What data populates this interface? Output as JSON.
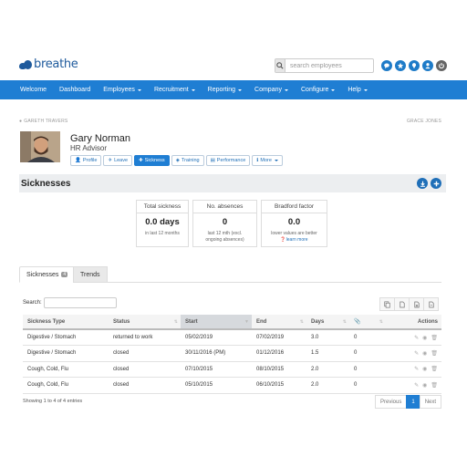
{
  "app": {
    "logo_text": "breathe",
    "brand_color": "#1f7ed3"
  },
  "search": {
    "placeholder": "search employees"
  },
  "top_icons": [
    "chat-icon",
    "star-icon",
    "pin-icon",
    "user-icon",
    "power-icon"
  ],
  "nav": {
    "items": [
      {
        "label": "Welcome",
        "dropdown": false
      },
      {
        "label": "Dashboard",
        "dropdown": false
      },
      {
        "label": "Employees",
        "dropdown": true
      },
      {
        "label": "Recruitment",
        "dropdown": true
      },
      {
        "label": "Reporting",
        "dropdown": true
      },
      {
        "label": "Company",
        "dropdown": true
      },
      {
        "label": "Configure",
        "dropdown": true
      },
      {
        "label": "Help",
        "dropdown": true
      }
    ]
  },
  "breadcrumbs": {
    "prev": "GARETH TRAVERS",
    "next": "GRACE JONES"
  },
  "employee": {
    "name": "Gary Norman",
    "role": "HR Advisor",
    "tabs": [
      {
        "label": "Profile",
        "icon": "user-icon",
        "active": false
      },
      {
        "label": "Leave",
        "icon": "plane-icon",
        "active": false
      },
      {
        "label": "Sickness",
        "icon": "medical-icon",
        "active": true
      },
      {
        "label": "Training",
        "icon": "graduation-cap-icon",
        "active": false
      },
      {
        "label": "Performance",
        "icon": "chart-icon",
        "active": false
      },
      {
        "label": "More",
        "icon": "info-icon",
        "active": false,
        "dropdown": true
      }
    ]
  },
  "section": {
    "title": "Sicknesses"
  },
  "stats": {
    "total": {
      "title": "Total sickness",
      "value": "0.0 days",
      "sub": "in last 12 months"
    },
    "absences": {
      "title": "No. absences",
      "value": "0",
      "sub_line1": "last 12 mth (excl.",
      "sub_line2": "ongoing absences)"
    },
    "bradford": {
      "title": "Bradford factor",
      "value": "0.0",
      "sub": "lower values are better",
      "link": "learn more"
    }
  },
  "tabs": {
    "active": "Sicknesses",
    "badge": "4",
    "inactive": "Trends"
  },
  "table": {
    "search_label": "Search:",
    "columns": [
      "Sickness Type",
      "Status",
      "Start",
      "End",
      "Days",
      "",
      "Actions"
    ],
    "rows": [
      [
        "Digestive / Stomach",
        "returned to work",
        "05/02/2019",
        "07/02/2019",
        "3.0",
        "0"
      ],
      [
        "Digestive / Stomach",
        "closed",
        "30/11/2016 (PM)",
        "01/12/2016",
        "1.5",
        "0"
      ],
      [
        "Cough, Cold, Flu",
        "closed",
        "07/10/2015",
        "08/10/2015",
        "2.0",
        "0"
      ],
      [
        "Cough, Cold, Flu",
        "closed",
        "05/10/2015",
        "06/10/2015",
        "2.0",
        "0"
      ]
    ],
    "info": "Showing 1 to 4 of 4 entries",
    "pager": {
      "prev": "Previous",
      "current": "1",
      "next": "Next"
    }
  }
}
